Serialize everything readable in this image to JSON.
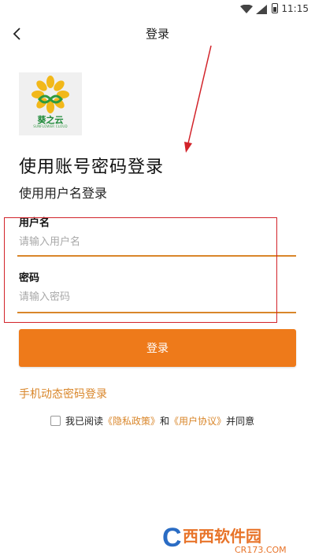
{
  "status_bar": {
    "time": "11:15"
  },
  "app_bar": {
    "title": "登录",
    "back_icon": "chevron-left-icon"
  },
  "logo": {
    "text": "葵之云",
    "subtext": "SUNFLOWER CLOUD"
  },
  "heading": "使用账号密码登录",
  "subheading": "使用用户名登录",
  "form": {
    "username_label": "用户名",
    "username_placeholder": "请输入用户名",
    "password_label": "密码",
    "password_placeholder": "请输入密码"
  },
  "login_button": "登录",
  "sms_login_link": "手机动态密码登录",
  "agreement": {
    "prefix": "我已阅读",
    "privacy_link": "《隐私政策》",
    "and": "和",
    "user_agreement_link": "《用户协议》",
    "suffix": "并同意"
  },
  "watermark": {
    "brand": "西西软件园",
    "url": "CR173.COM"
  },
  "colors": {
    "accent": "#ee7a1a",
    "link": "#d9862a",
    "annotation": "#d2232a"
  }
}
